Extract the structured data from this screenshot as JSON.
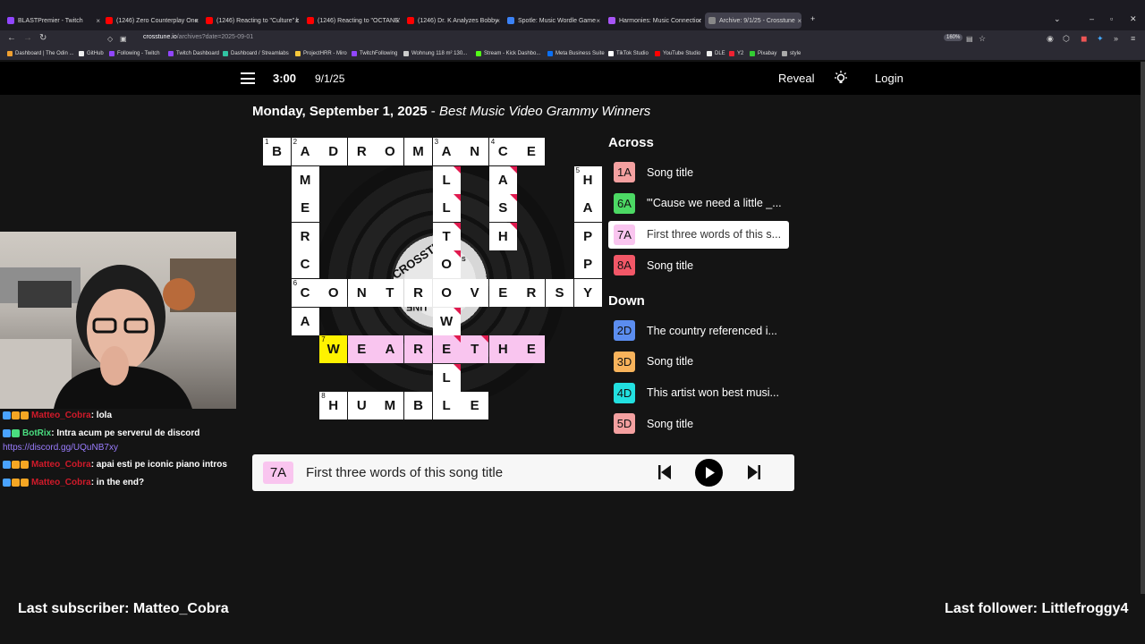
{
  "browser": {
    "tabs": [
      {
        "label": "BLASTPremier - Twitch",
        "color": "#9146ff"
      },
      {
        "label": "(1246) Zero Counterplay Onesh",
        "color": "#ff0000"
      },
      {
        "label": "(1246) Reacting to \"Culture\" by",
        "color": "#ff0000"
      },
      {
        "label": "(1246) Reacting to \"OCTANE\" b",
        "color": "#ff0000"
      },
      {
        "label": "(1246) Dr. K Analyzes Bobby Le",
        "color": "#ff0000"
      },
      {
        "label": "Spotle: Music Wordle Game",
        "color": "#3b82f6"
      },
      {
        "label": "Harmonies: Music Connection",
        "color": "#a855f7"
      },
      {
        "label": "Archive: 9/1/25 - Crosstune",
        "color": "#888888"
      }
    ],
    "url_host": "crosstune.io",
    "url_path": "/archives?date=2025-09-01",
    "zoom": "160%",
    "bookmarks": [
      "Dashboard | The Odin ...",
      "GitHub",
      "Following - Twitch",
      "Twitch Dashboard",
      "Dashboard / Streamlabs",
      "ProjectHRR - Miro",
      "TwitchFollowing",
      "Wohnung 118 m² 130...",
      "Stream - Kick Dashbo...",
      "Meta Business Suite",
      "TikTok Studio",
      "YouTube Studio",
      "DLE",
      "Y2",
      "Pixabay",
      "style"
    ]
  },
  "header": {
    "timer": "3:00",
    "date": "9/1/25",
    "reveal": "Reveal",
    "login": "Login"
  },
  "puzzle": {
    "title_date": "Monday, September 1, 2025",
    "title_sep": " - ",
    "title_theme": "Best Music Video Grammy Winners",
    "vinyl_label_top": "CROSSTU",
    "vinyl_label_bottom": "UNE",
    "vinyl_label_small": "S",
    "cells": [
      {
        "r": 0,
        "c": 0,
        "ch": "B",
        "num": "1"
      },
      {
        "r": 0,
        "c": 1,
        "ch": "A",
        "num": "2"
      },
      {
        "r": 0,
        "c": 2,
        "ch": "D"
      },
      {
        "r": 0,
        "c": 3,
        "ch": "R"
      },
      {
        "r": 0,
        "c": 4,
        "ch": "O"
      },
      {
        "r": 0,
        "c": 5,
        "ch": "M"
      },
      {
        "r": 0,
        "c": 6,
        "ch": "A",
        "num": "3"
      },
      {
        "r": 0,
        "c": 7,
        "ch": "N"
      },
      {
        "r": 0,
        "c": 8,
        "ch": "C",
        "num": "4"
      },
      {
        "r": 0,
        "c": 9,
        "ch": "E"
      },
      {
        "r": 1,
        "c": 1,
        "ch": "M"
      },
      {
        "r": 1,
        "c": 6,
        "ch": "L",
        "flag": true
      },
      {
        "r": 1,
        "c": 8,
        "ch": "A",
        "flag": true
      },
      {
        "r": 1,
        "c": 11,
        "ch": "H",
        "num": "5"
      },
      {
        "r": 2,
        "c": 1,
        "ch": "E"
      },
      {
        "r": 2,
        "c": 6,
        "ch": "L",
        "flag": true
      },
      {
        "r": 2,
        "c": 8,
        "ch": "S",
        "flag": true
      },
      {
        "r": 2,
        "c": 11,
        "ch": "A"
      },
      {
        "r": 3,
        "c": 1,
        "ch": "R"
      },
      {
        "r": 3,
        "c": 6,
        "ch": "T",
        "flag": true
      },
      {
        "r": 3,
        "c": 8,
        "ch": "H",
        "flag": true
      },
      {
        "r": 3,
        "c": 11,
        "ch": "P"
      },
      {
        "r": 4,
        "c": 1,
        "ch": "C"
      },
      {
        "r": 4,
        "c": 6,
        "ch": "O",
        "flag": true
      },
      {
        "r": 4,
        "c": 11,
        "ch": "P"
      },
      {
        "r": 5,
        "c": 1,
        "ch": "C",
        "num": "6"
      },
      {
        "r": 5,
        "c": 2,
        "ch": "O"
      },
      {
        "r": 5,
        "c": 3,
        "ch": "N"
      },
      {
        "r": 5,
        "c": 4,
        "ch": "T"
      },
      {
        "r": 5,
        "c": 5,
        "ch": "R"
      },
      {
        "r": 5,
        "c": 6,
        "ch": "O"
      },
      {
        "r": 5,
        "c": 7,
        "ch": "V"
      },
      {
        "r": 5,
        "c": 8,
        "ch": "E"
      },
      {
        "r": 5,
        "c": 9,
        "ch": "R"
      },
      {
        "r": 5,
        "c": 10,
        "ch": "S"
      },
      {
        "r": 5,
        "c": 11,
        "ch": "Y"
      },
      {
        "r": 6,
        "c": 1,
        "ch": "A"
      },
      {
        "r": 6,
        "c": 6,
        "ch": "W",
        "flag": true
      },
      {
        "r": 7,
        "c": 2,
        "ch": "W",
        "num": "7",
        "style": "yellow"
      },
      {
        "r": 7,
        "c": 3,
        "ch": "E",
        "style": "pink"
      },
      {
        "r": 7,
        "c": 4,
        "ch": "A",
        "style": "pink"
      },
      {
        "r": 7,
        "c": 5,
        "ch": "R",
        "style": "pink"
      },
      {
        "r": 7,
        "c": 6,
        "ch": "E",
        "style": "pink",
        "flag": true
      },
      {
        "r": 7,
        "c": 7,
        "ch": "T",
        "style": "pink",
        "flag": true
      },
      {
        "r": 7,
        "c": 8,
        "ch": "H",
        "style": "pink"
      },
      {
        "r": 7,
        "c": 9,
        "ch": "E",
        "style": "pink"
      },
      {
        "r": 8,
        "c": 6,
        "ch": "L",
        "flag": true
      },
      {
        "r": 9,
        "c": 2,
        "ch": "H",
        "num": "8"
      },
      {
        "r": 9,
        "c": 3,
        "ch": "U"
      },
      {
        "r": 9,
        "c": 4,
        "ch": "M"
      },
      {
        "r": 9,
        "c": 5,
        "ch": "B"
      },
      {
        "r": 9,
        "c": 6,
        "ch": "L"
      },
      {
        "r": 9,
        "c": 7,
        "ch": "E"
      }
    ]
  },
  "clues": {
    "across_heading": "Across",
    "down_heading": "Down",
    "across": [
      {
        "id": "1A",
        "text": "Song title",
        "color": "#f4a0a0"
      },
      {
        "id": "6A",
        "text": "\"'Cause we need a little _...",
        "color": "#4cd964"
      },
      {
        "id": "7A",
        "text": "First three words of this s...",
        "color": "#f9c5ef",
        "active": true
      },
      {
        "id": "8A",
        "text": "Song title",
        "color": "#f25767"
      }
    ],
    "down": [
      {
        "id": "2D",
        "text": "The country referenced i...",
        "color": "#5b8def"
      },
      {
        "id": "3D",
        "text": "Song title",
        "color": "#f8b35b"
      },
      {
        "id": "4D",
        "text": "This artist won best musi...",
        "color": "#22e0e0"
      },
      {
        "id": "5D",
        "text": "Song title",
        "color": "#f4a0a0"
      }
    ]
  },
  "player": {
    "clue_id": "7A",
    "clue_text": "First three words of this song title"
  },
  "stream": {
    "chat": [
      {
        "user": "Matteo_Cobra",
        "msg": ": lola"
      },
      {
        "user": "BotRix",
        "msg": ": Intra acum pe serverul de discord",
        "user_color": "#4ade80"
      },
      {
        "user": "Matteo_Cobra",
        "msg": ": apai esti pe iconic piano intros"
      },
      {
        "user": "Matteo_Cobra",
        "msg": ": in the end?"
      }
    ],
    "chat_link": "https://discord.gg/UQuNB7xy",
    "last_subscriber": "Last subscriber: Matteo_Cobra",
    "last_follower": "Last follower: Littlefroggy4"
  }
}
